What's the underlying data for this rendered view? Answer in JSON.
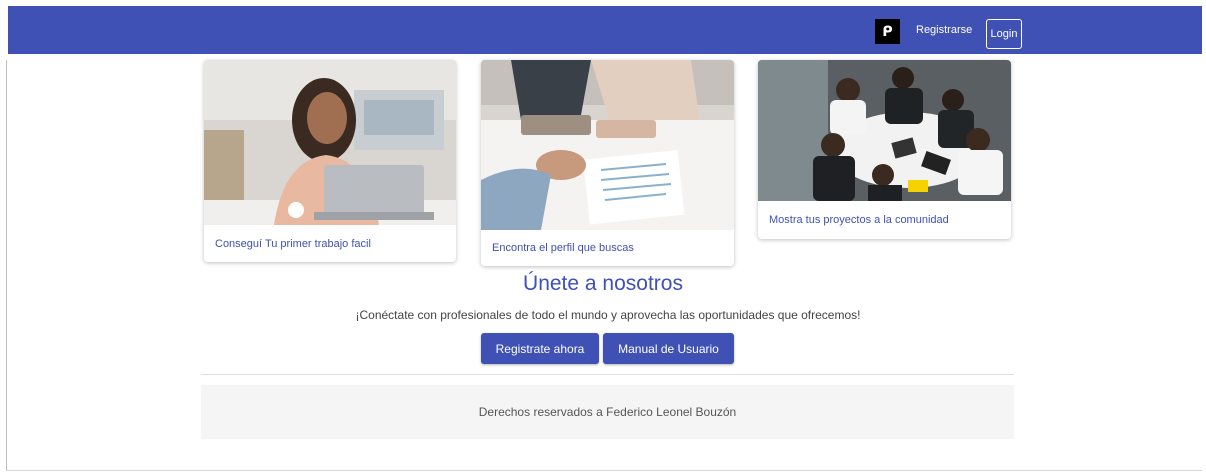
{
  "navbar": {
    "bg_color": "#3f51b5",
    "logo_icon": "p-logo-icon",
    "logo_glyph": "ᑭ",
    "register_label": "Registrarse",
    "login_label": "Login"
  },
  "cards": [
    {
      "caption": "Conseguí Tu primer trabajo facil",
      "image": "woman-at-laptop-photo"
    },
    {
      "caption": "Encontra el perfil que buscas",
      "image": "handshake-interview-photo"
    },
    {
      "caption": "Mostra tus proyectos a la comunidad",
      "image": "team-meeting-photo"
    }
  ],
  "join": {
    "title": "Únete a nosotros",
    "subtitle": "¡Conéctate con profesionales de todo el mundo y aprovecha las oportunidades que ofrecemos!",
    "register_button": "Registrate ahora",
    "manual_button": "Manual de Usuario"
  },
  "footer": {
    "text": "Derechos reservados a Federico Leonel Bouzón"
  }
}
